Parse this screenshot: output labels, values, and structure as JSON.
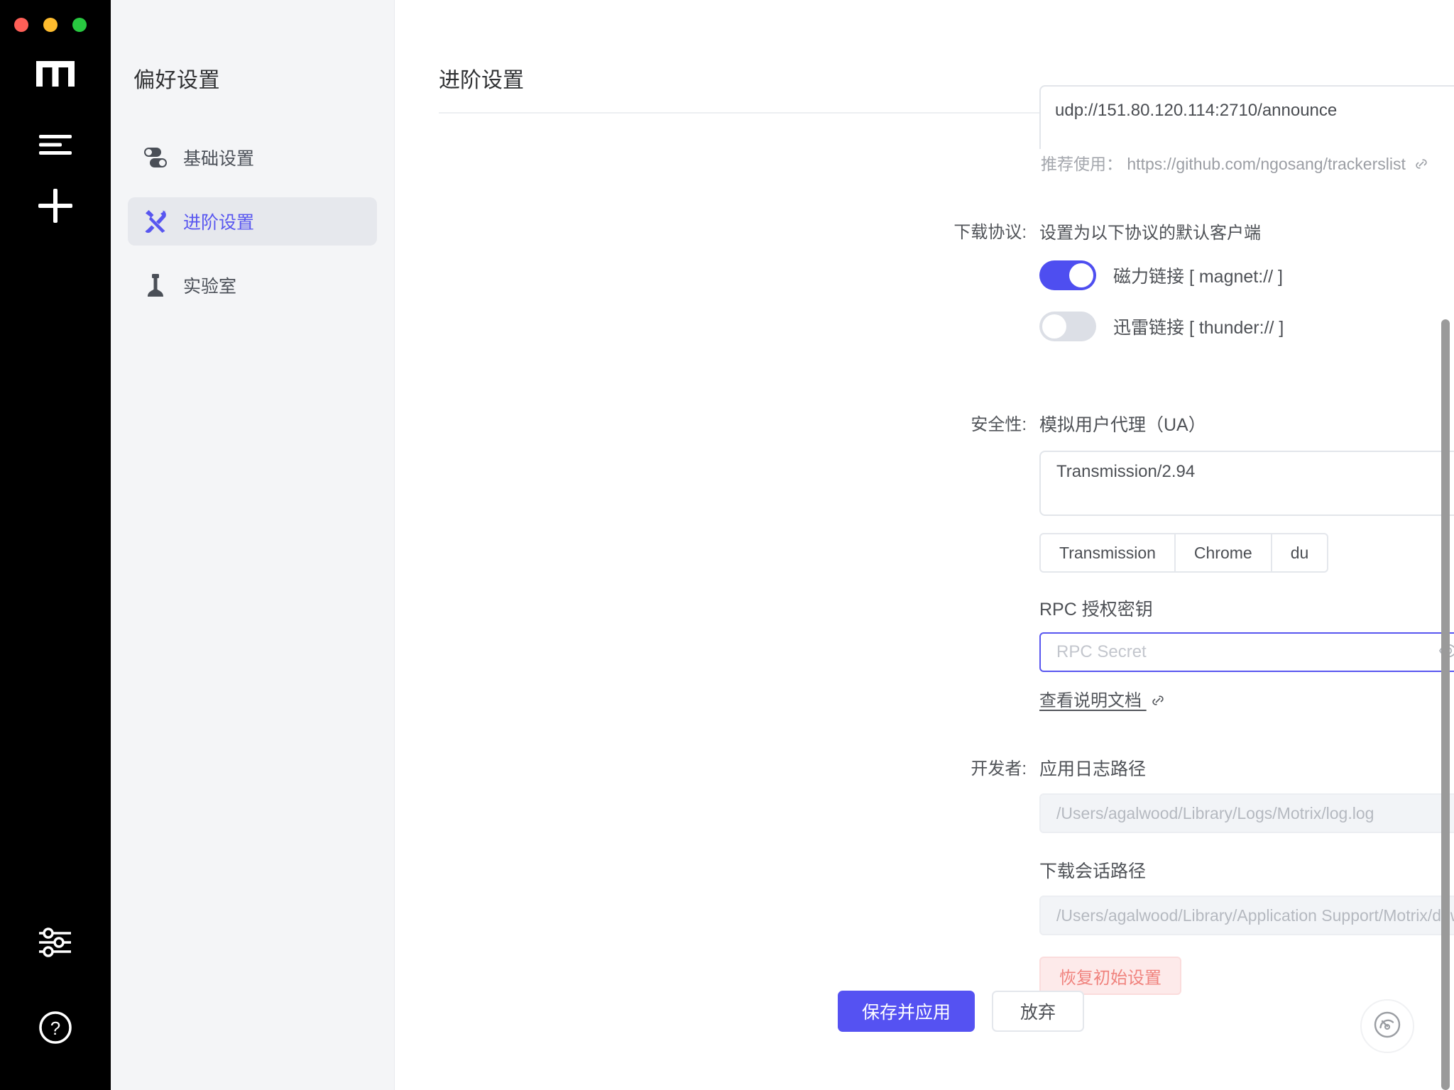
{
  "window": {
    "traffic_lights": [
      "close",
      "minimize",
      "maximize"
    ],
    "brand": "m"
  },
  "rail": {
    "items": [
      {
        "name": "task-list-icon",
        "label": "任务列表"
      },
      {
        "name": "add-task-icon",
        "label": "新建任务"
      }
    ],
    "bottom_items": [
      {
        "name": "preferences-icon",
        "label": "偏好设置"
      },
      {
        "name": "help-icon",
        "label": "帮助"
      }
    ]
  },
  "sidebar": {
    "title": "偏好设置",
    "items": [
      {
        "label": "基础设置",
        "icon": "toggles-icon",
        "active": false
      },
      {
        "label": "进阶设置",
        "icon": "tools-icon",
        "active": true
      },
      {
        "label": "实验室",
        "icon": "chess-pawn-icon",
        "active": false
      }
    ]
  },
  "main": {
    "title": "进阶设置",
    "trackers": {
      "value": "udp://151.80.120.114:2710/announce",
      "tip_label": "推荐使用：",
      "tip_link": "https://github.com/ngosang/trackerslist",
      "link_icon": "external-link-icon"
    },
    "protocol": {
      "label": "下载协议:",
      "description": "设置为以下协议的默认客户端",
      "toggles": [
        {
          "label": "磁力链接 [ magnet:// ]",
          "on": true
        },
        {
          "label": "迅雷链接 [ thunder:// ]",
          "on": false
        }
      ]
    },
    "security": {
      "label": "安全性:",
      "ua_title": "模拟用户代理（UA）",
      "ua_value": "Transmission/2.94",
      "ua_presets": [
        "Transmission",
        "Chrome",
        "du"
      ],
      "rpc_title": "RPC 授权密钥",
      "rpc_placeholder": "RPC Secret",
      "rpc_value": "",
      "eye_icon": "eye-icon",
      "generate_icon": "dice-icon",
      "doc_link": "查看说明文档",
      "doc_link_icon": "external-link-icon"
    },
    "developer": {
      "label": "开发者:",
      "log_title": "应用日志路径",
      "log_path": "/Users/agalwood/Library/Logs/Motrix/log.log",
      "session_title": "下载会话路径",
      "session_path": "/Users/agalwood/Library/Application Support/Motrix/download.session",
      "folder_icon": "folder-icon",
      "reset_button": "恢复初始设置"
    },
    "footer": {
      "save_label": "保存并应用",
      "discard_label": "放弃"
    },
    "fab": {
      "icon": "speed-gauge-icon"
    }
  },
  "colors": {
    "accent": "#5856f0",
    "rail_bg": "#000000",
    "sidebar_bg": "#f4f5f7",
    "danger": "#f0827d",
    "toggle_on": "#4e4ef0",
    "toggle_off": "#dcdfe6"
  }
}
